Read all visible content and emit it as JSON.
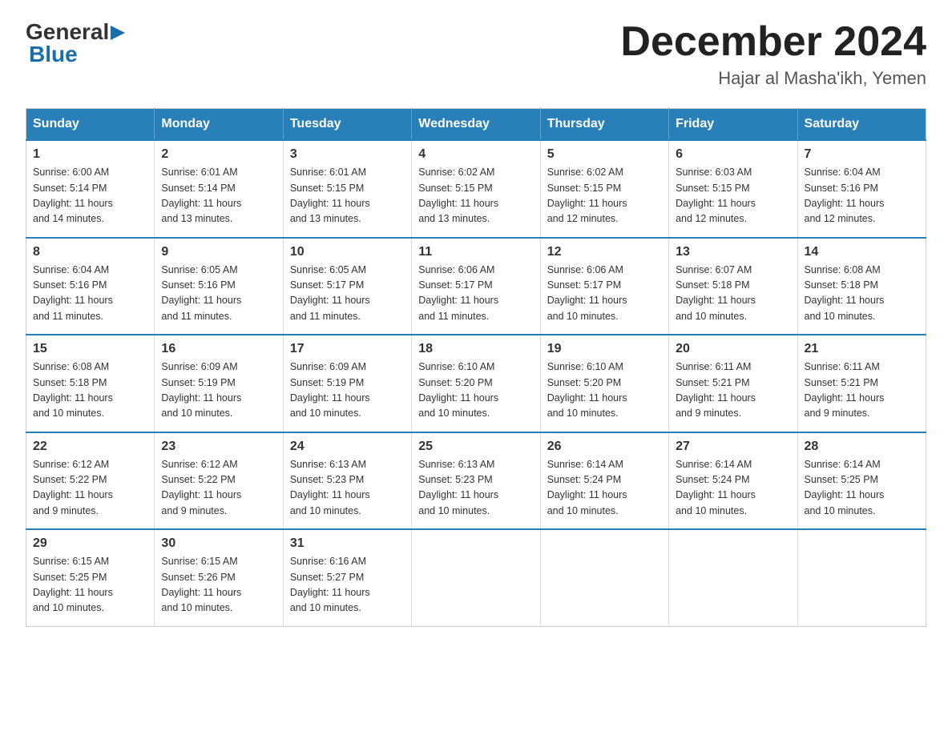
{
  "logo": {
    "general": "General",
    "arrow": "▶",
    "blue": "Blue"
  },
  "title": "December 2024",
  "subtitle": "Hajar al Masha'ikh, Yemen",
  "days_of_week": [
    "Sunday",
    "Monday",
    "Tuesday",
    "Wednesday",
    "Thursday",
    "Friday",
    "Saturday"
  ],
  "weeks": [
    [
      {
        "day": "1",
        "sunrise": "6:00 AM",
        "sunset": "5:14 PM",
        "daylight": "11 hours and 14 minutes."
      },
      {
        "day": "2",
        "sunrise": "6:01 AM",
        "sunset": "5:14 PM",
        "daylight": "11 hours and 13 minutes."
      },
      {
        "day": "3",
        "sunrise": "6:01 AM",
        "sunset": "5:15 PM",
        "daylight": "11 hours and 13 minutes."
      },
      {
        "day": "4",
        "sunrise": "6:02 AM",
        "sunset": "5:15 PM",
        "daylight": "11 hours and 13 minutes."
      },
      {
        "day": "5",
        "sunrise": "6:02 AM",
        "sunset": "5:15 PM",
        "daylight": "11 hours and 12 minutes."
      },
      {
        "day": "6",
        "sunrise": "6:03 AM",
        "sunset": "5:15 PM",
        "daylight": "11 hours and 12 minutes."
      },
      {
        "day": "7",
        "sunrise": "6:04 AM",
        "sunset": "5:16 PM",
        "daylight": "11 hours and 12 minutes."
      }
    ],
    [
      {
        "day": "8",
        "sunrise": "6:04 AM",
        "sunset": "5:16 PM",
        "daylight": "11 hours and 11 minutes."
      },
      {
        "day": "9",
        "sunrise": "6:05 AM",
        "sunset": "5:16 PM",
        "daylight": "11 hours and 11 minutes."
      },
      {
        "day": "10",
        "sunrise": "6:05 AM",
        "sunset": "5:17 PM",
        "daylight": "11 hours and 11 minutes."
      },
      {
        "day": "11",
        "sunrise": "6:06 AM",
        "sunset": "5:17 PM",
        "daylight": "11 hours and 11 minutes."
      },
      {
        "day": "12",
        "sunrise": "6:06 AM",
        "sunset": "5:17 PM",
        "daylight": "11 hours and 10 minutes."
      },
      {
        "day": "13",
        "sunrise": "6:07 AM",
        "sunset": "5:18 PM",
        "daylight": "11 hours and 10 minutes."
      },
      {
        "day": "14",
        "sunrise": "6:08 AM",
        "sunset": "5:18 PM",
        "daylight": "11 hours and 10 minutes."
      }
    ],
    [
      {
        "day": "15",
        "sunrise": "6:08 AM",
        "sunset": "5:18 PM",
        "daylight": "11 hours and 10 minutes."
      },
      {
        "day": "16",
        "sunrise": "6:09 AM",
        "sunset": "5:19 PM",
        "daylight": "11 hours and 10 minutes."
      },
      {
        "day": "17",
        "sunrise": "6:09 AM",
        "sunset": "5:19 PM",
        "daylight": "11 hours and 10 minutes."
      },
      {
        "day": "18",
        "sunrise": "6:10 AM",
        "sunset": "5:20 PM",
        "daylight": "11 hours and 10 minutes."
      },
      {
        "day": "19",
        "sunrise": "6:10 AM",
        "sunset": "5:20 PM",
        "daylight": "11 hours and 10 minutes."
      },
      {
        "day": "20",
        "sunrise": "6:11 AM",
        "sunset": "5:21 PM",
        "daylight": "11 hours and 9 minutes."
      },
      {
        "day": "21",
        "sunrise": "6:11 AM",
        "sunset": "5:21 PM",
        "daylight": "11 hours and 9 minutes."
      }
    ],
    [
      {
        "day": "22",
        "sunrise": "6:12 AM",
        "sunset": "5:22 PM",
        "daylight": "11 hours and 9 minutes."
      },
      {
        "day": "23",
        "sunrise": "6:12 AM",
        "sunset": "5:22 PM",
        "daylight": "11 hours and 9 minutes."
      },
      {
        "day": "24",
        "sunrise": "6:13 AM",
        "sunset": "5:23 PM",
        "daylight": "11 hours and 10 minutes."
      },
      {
        "day": "25",
        "sunrise": "6:13 AM",
        "sunset": "5:23 PM",
        "daylight": "11 hours and 10 minutes."
      },
      {
        "day": "26",
        "sunrise": "6:14 AM",
        "sunset": "5:24 PM",
        "daylight": "11 hours and 10 minutes."
      },
      {
        "day": "27",
        "sunrise": "6:14 AM",
        "sunset": "5:24 PM",
        "daylight": "11 hours and 10 minutes."
      },
      {
        "day": "28",
        "sunrise": "6:14 AM",
        "sunset": "5:25 PM",
        "daylight": "11 hours and 10 minutes."
      }
    ],
    [
      {
        "day": "29",
        "sunrise": "6:15 AM",
        "sunset": "5:25 PM",
        "daylight": "11 hours and 10 minutes."
      },
      {
        "day": "30",
        "sunrise": "6:15 AM",
        "sunset": "5:26 PM",
        "daylight": "11 hours and 10 minutes."
      },
      {
        "day": "31",
        "sunrise": "6:16 AM",
        "sunset": "5:27 PM",
        "daylight": "11 hours and 10 minutes."
      },
      null,
      null,
      null,
      null
    ]
  ],
  "labels": {
    "sunrise": "Sunrise:",
    "sunset": "Sunset:",
    "daylight": "Daylight:"
  }
}
